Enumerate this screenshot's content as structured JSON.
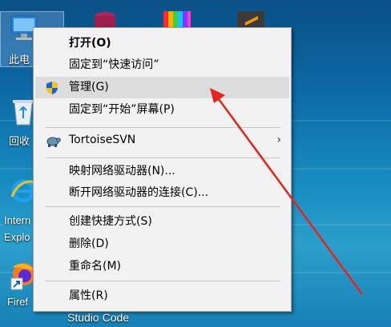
{
  "desktop": {
    "icons": [
      {
        "label": "此电"
      },
      {
        "label": "回收"
      },
      {
        "label": "Intern"
      },
      {
        "label": "Explo"
      },
      {
        "label": "Firef"
      },
      {
        "label": "Studio Code"
      }
    ]
  },
  "context_menu": {
    "items": [
      {
        "label": "打开(O)"
      },
      {
        "label": "固定到“快速访问”"
      },
      {
        "label": "管理(G)"
      },
      {
        "label": "固定到“开始”屏幕(P)"
      },
      {
        "label": "TortoiseSVN"
      },
      {
        "label": "映射网络驱动器(N)..."
      },
      {
        "label": "断开网络驱动器的连接(C)..."
      },
      {
        "label": "创建快捷方式(S)"
      },
      {
        "label": "删除(D)"
      },
      {
        "label": "重命名(M)"
      },
      {
        "label": "属性(R)"
      }
    ],
    "submenu_arrow": "›"
  },
  "annotation": {
    "color": "#e8231f"
  }
}
